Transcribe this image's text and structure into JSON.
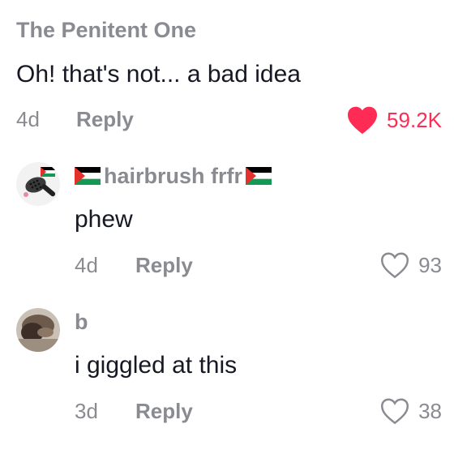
{
  "comment": {
    "username": "The Penitent One",
    "text": "Oh! that's not... a bad idea",
    "time": "4d",
    "reply_label": "Reply",
    "likes": "59.2K",
    "liked": true,
    "like_color": "#fe2c55"
  },
  "replies": [
    {
      "username": "hairbrush frfr",
      "text": "phew",
      "time": "4d",
      "reply_label": "Reply",
      "likes": "93",
      "liked": false
    },
    {
      "username": "b",
      "text": "i giggled at this",
      "time": "3d",
      "reply_label": "Reply",
      "likes": "38",
      "liked": false
    }
  ],
  "colors": {
    "muted": "#8a8b91",
    "text": "#161823",
    "accent": "#fe2c55"
  },
  "icons": {
    "like_filled": "heart-filled-icon",
    "like_outline": "heart-outline-icon",
    "flag": "palestine-flag-icon"
  }
}
